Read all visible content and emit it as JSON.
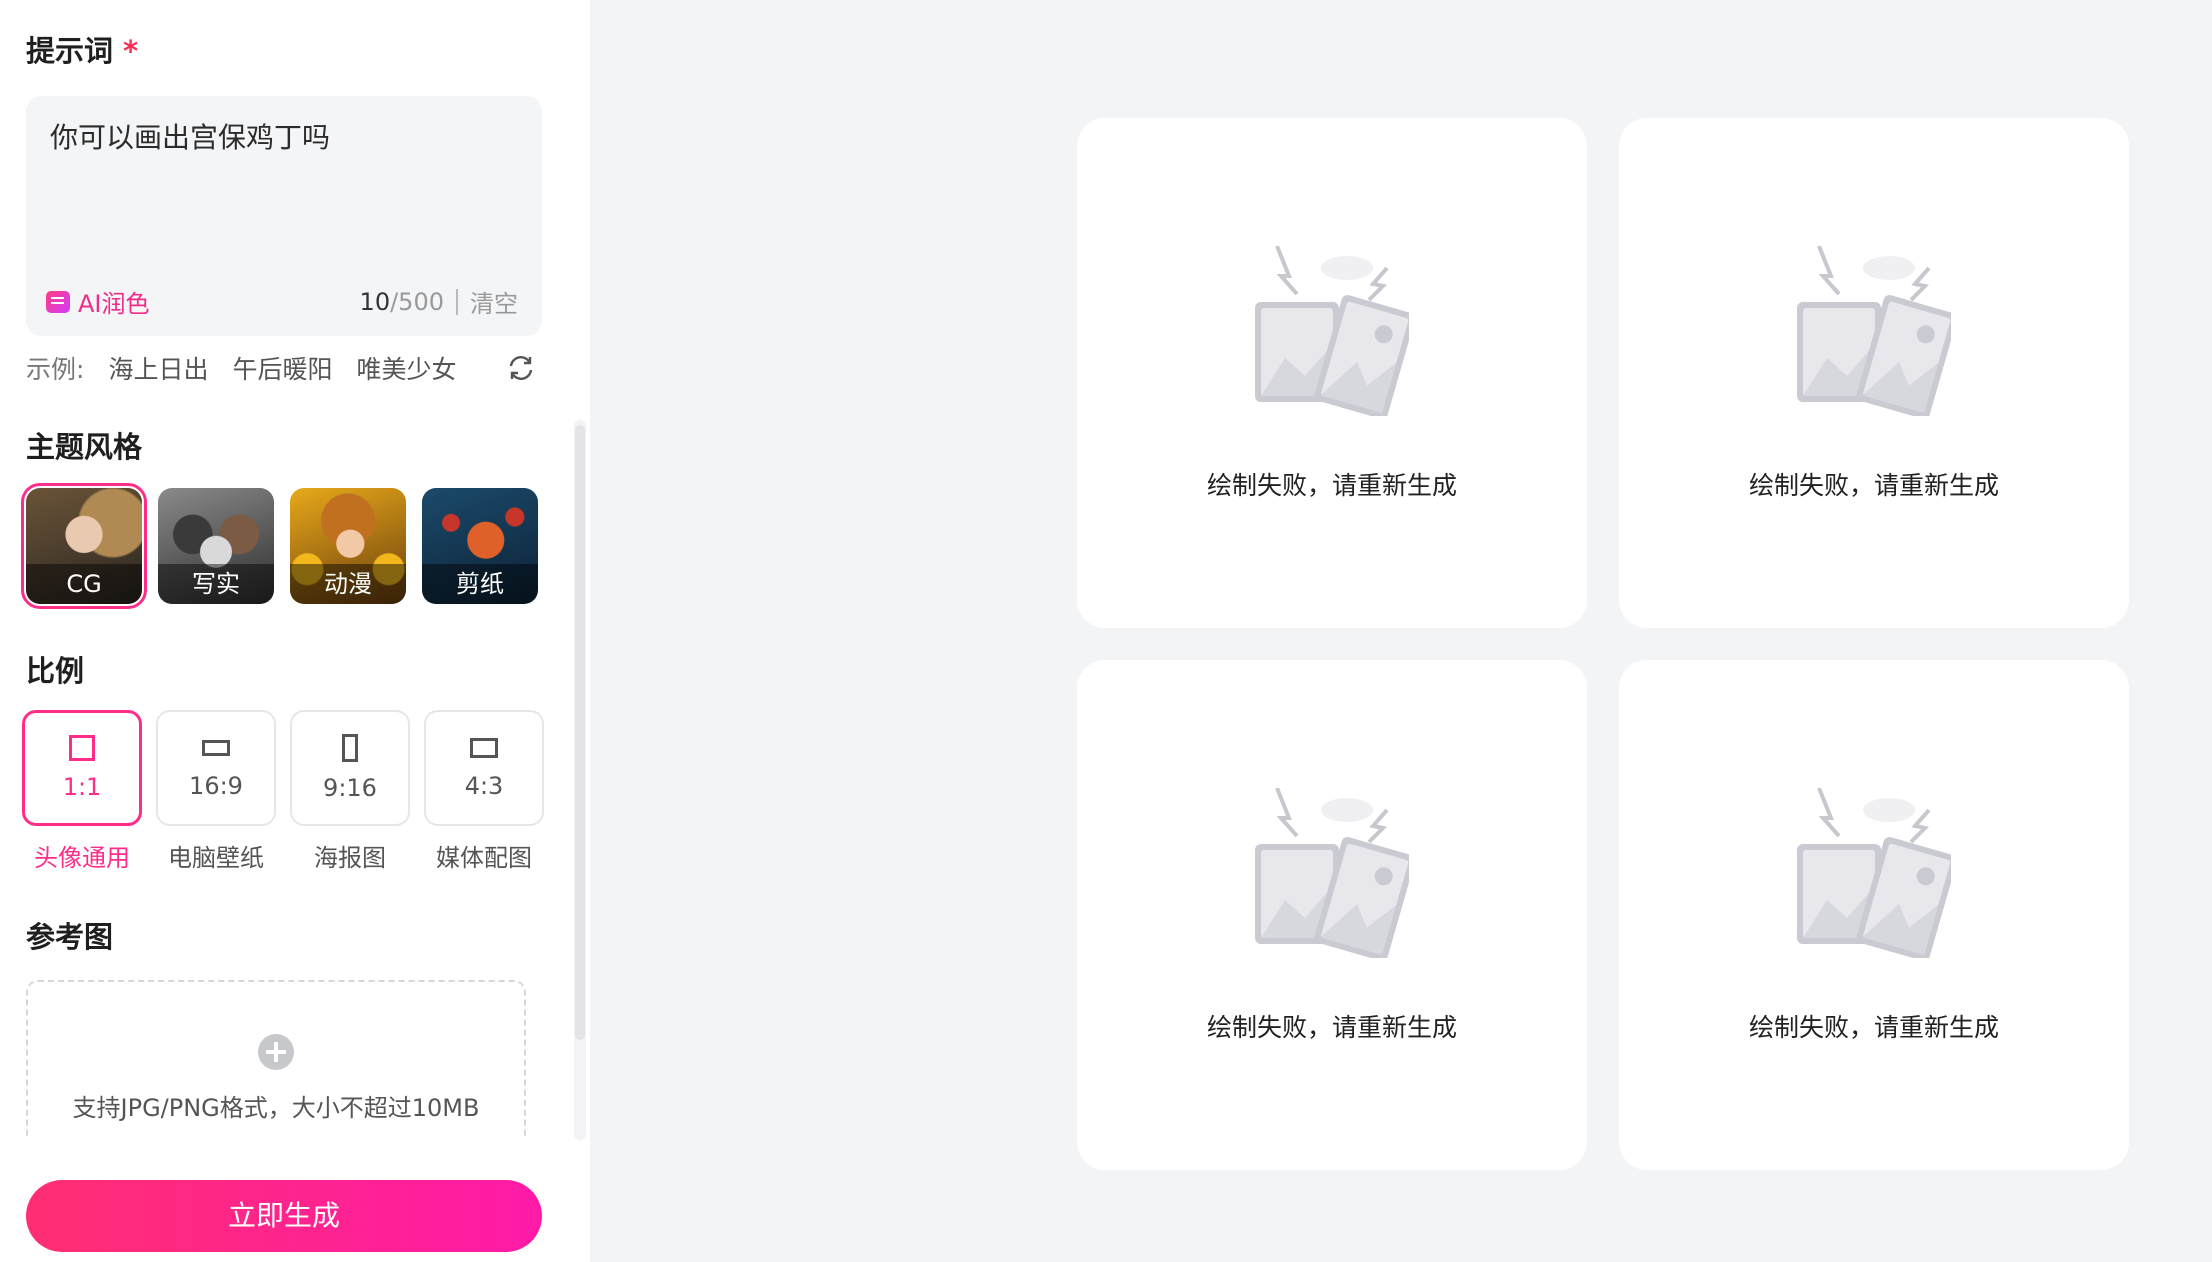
{
  "prompt": {
    "title": "提示词",
    "required_mark": "*",
    "text": "你可以画出宫保鸡丁吗",
    "ai_polish_label": "AI润色",
    "count_current": "10",
    "count_max": "/500",
    "clear_label": "清空"
  },
  "examples": {
    "lead": "示例:",
    "items": [
      "海上日出",
      "午后暖阳",
      "唯美少女"
    ]
  },
  "style": {
    "title": "主题风格",
    "items": [
      {
        "label": "CG",
        "selected": true
      },
      {
        "label": "写实",
        "selected": false
      },
      {
        "label": "动漫",
        "selected": false
      },
      {
        "label": "剪纸",
        "selected": false
      }
    ]
  },
  "ratio": {
    "title": "比例",
    "items": [
      {
        "value": "1:1",
        "name": "头像通用",
        "selected": true
      },
      {
        "value": "16:9",
        "name": "电脑壁纸",
        "selected": false
      },
      {
        "value": "9:16",
        "name": "海报图",
        "selected": false
      },
      {
        "value": "4:3",
        "name": "媒体配图",
        "selected": false
      }
    ]
  },
  "reference": {
    "title": "参考图",
    "hint": "支持JPG/PNG格式，大小不超过10MB"
  },
  "generate_label": "立即生成",
  "results": [
    {
      "message": "绘制失败，请重新生成"
    },
    {
      "message": "绘制失败，请重新生成"
    },
    {
      "message": "绘制失败，请重新生成"
    },
    {
      "message": "绘制失败，请重新生成"
    }
  ],
  "colors": {
    "accent": "#ff2d8a",
    "page_bg": "#f3f4f6",
    "card_bg": "#ffffff"
  }
}
